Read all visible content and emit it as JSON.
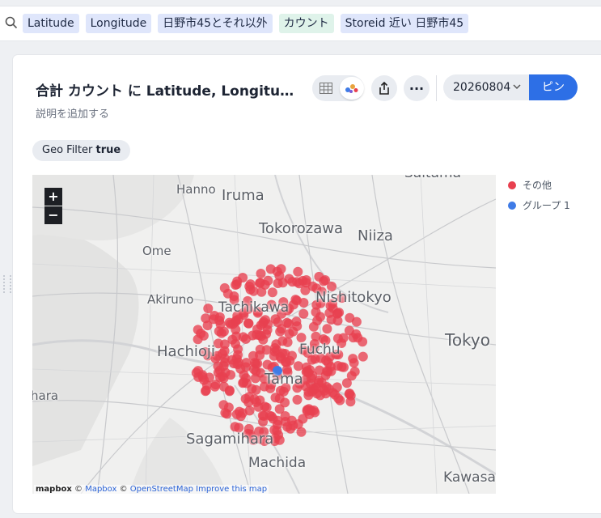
{
  "query": {
    "tokens": [
      {
        "label": "Latitude",
        "kind": "attribute"
      },
      {
        "label": "Longitude",
        "kind": "attribute"
      },
      {
        "label": "日野市45とそれ以外",
        "kind": "attribute"
      },
      {
        "label": "カウント",
        "kind": "measure"
      },
      {
        "label": "Storeid 近い 日野市45",
        "kind": "attribute"
      }
    ]
  },
  "card": {
    "title": "合計 カウント に Latitude, Longitude ...",
    "description_placeholder": "説明を追加する",
    "filter": {
      "name": "Geo Filter",
      "value": "true"
    },
    "date_value": "20260804",
    "pin_label": "ピン",
    "more_label": "···"
  },
  "map": {
    "zoom_in": "+",
    "zoom_out": "−",
    "places": {
      "saitama": "Saitama",
      "hanno": "Hanno",
      "iruma": "Iruma",
      "tokorozawa": "Tokorozawa",
      "niiza": "Niiza",
      "ome": "Ome",
      "akiruno": "Akiruno",
      "nishitokyo": "Nishitokyo",
      "tachikawa": "Tachikawa",
      "hachioji": "Hachioji",
      "fuchu": "Fuchu",
      "tama": "Tama",
      "tokyo": "Tokyo",
      "hara": "hara",
      "sagamihara": "Sagamihara",
      "machida": "Machida",
      "kawasaki": "Kawasa"
    },
    "attribution": {
      "logo": "mapbox",
      "copy1": "©",
      "mapbox": "Mapbox",
      "copy2": "©",
      "osm": "OpenStreetMap",
      "improve": "Improve this map"
    }
  },
  "legend": [
    {
      "label": "その他",
      "color": "#e8404f"
    },
    {
      "label": "グループ 1",
      "color": "#3f7be6"
    }
  ],
  "colors": {
    "accent": "#2d6fe6",
    "other_points": "#e8404f",
    "group1_point": "#3f7be6"
  }
}
